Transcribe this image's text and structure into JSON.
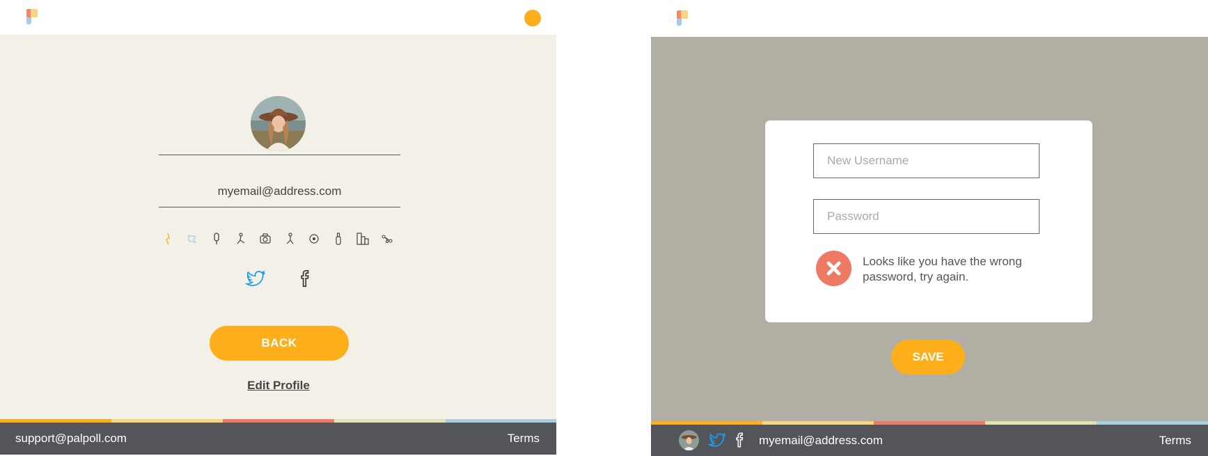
{
  "left": {
    "email": "myemail@address.com",
    "back_label": "BACK",
    "edit_profile_label": "Edit Profile",
    "footer": {
      "support_email": "support@palpoll.com",
      "terms_label": "Terms"
    },
    "icons": [
      "sparkle-icon",
      "flag-icon",
      "microphone-icon",
      "figure-icon",
      "camera-icon",
      "person-icon",
      "target-icon",
      "bottle-icon",
      "buildings-icon",
      "connections-icon"
    ]
  },
  "right": {
    "username_placeholder": "New Username",
    "password_placeholder": "Password",
    "error_text": "Looks like you have the wrong password, try again.",
    "save_label": "SAVE",
    "footer": {
      "email": "myemail@address.com",
      "terms_label": "Terms"
    }
  },
  "colors": {
    "accent": "#fdae1b",
    "cream": "#f3f1e7",
    "overlay": "#b1afa3",
    "footer": "#53555a",
    "error": "#ef7a64",
    "twitter": "#1d9bf0",
    "stripes": [
      "#fdae1b",
      "#f8d57e",
      "#ef7a64",
      "#dde6b3",
      "#a5cde6"
    ]
  }
}
